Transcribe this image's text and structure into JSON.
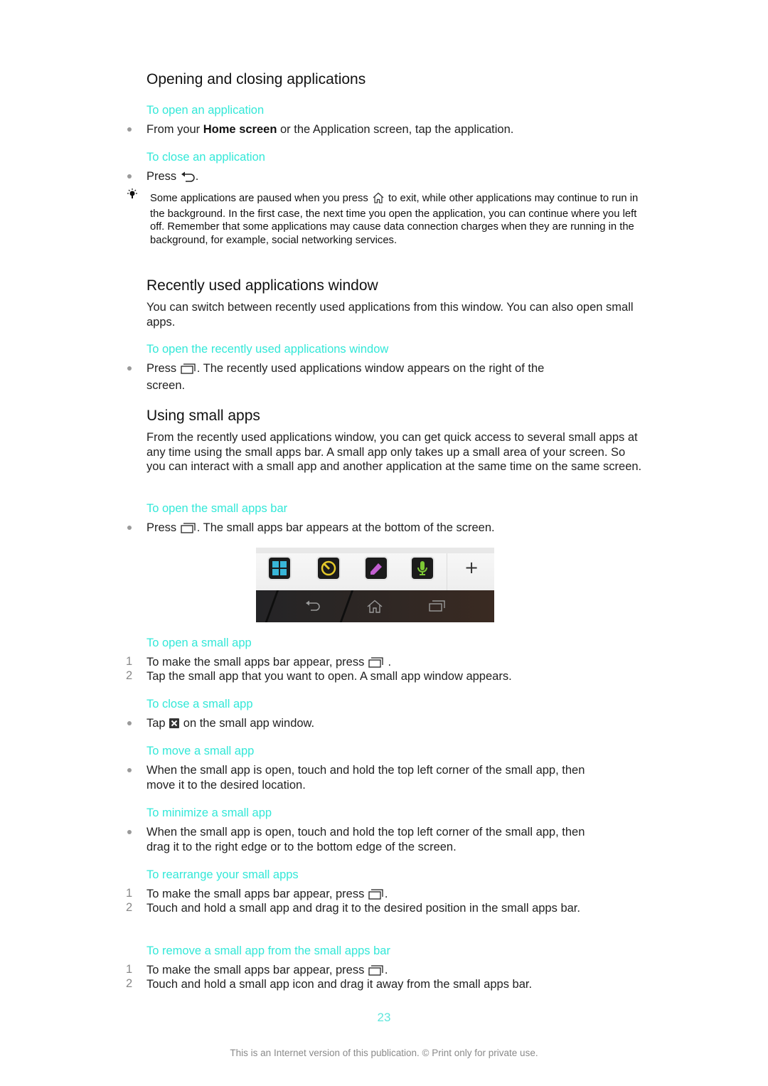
{
  "sections": {
    "opening": {
      "title": "Opening and closing applications",
      "open_heading": "To open an application",
      "open_step_pre": "From your ",
      "open_step_bold": "Home screen",
      "open_step_post": " or the Application screen, tap the application.",
      "close_heading": "To close an application",
      "close_step_pre": "Press ",
      "close_step_post": ".",
      "tip_pre": "Some applications are paused when you press ",
      "tip_post": " to exit, while other applications may continue to run in the background. In the first case, the next time you open the application, you can continue where you left off. Remember that some applications may cause data connection charges when they are running in the background, for example, social networking services."
    },
    "recent": {
      "title": "Recently used applications window",
      "intro": "You can switch between recently used applications from this window. You can also open small apps.",
      "open_heading": "To open the recently used applications window",
      "open_step_pre": "Press ",
      "open_step_post": ". The recently used applications window appears on the right of the screen."
    },
    "small_apps": {
      "title": "Using small apps",
      "intro": "From the recently used applications window, you can get quick access to several small apps at any time using the small apps bar. A small app only takes up a small area of your screen. So you can interact with a small app and another application at the same time on the same screen.",
      "bar_heading": "To open the small apps bar",
      "bar_step_pre": "Press ",
      "bar_step_post": ". The small apps bar appears at the bottom of the screen.",
      "screenshot": {
        "apps": [
          "calculator",
          "timer",
          "notes",
          "voice-recorder"
        ],
        "add_label": "+",
        "nav": [
          "back",
          "home",
          "recent-apps"
        ]
      },
      "open_app": {
        "heading": "To open a small app",
        "steps": [
          {
            "n": "1",
            "pre": "To make the small apps bar appear, press ",
            "post": " ."
          },
          {
            "n": "2",
            "text": "Tap the small app that you want to open. A small app window appears."
          }
        ]
      },
      "close_app": {
        "heading": "To close a small app",
        "pre": "Tap ",
        "post": " on the small app window."
      },
      "move_app": {
        "heading": "To move a small app",
        "text": "When the small app is open, touch and hold the top left corner of the small app, then move it to the desired location."
      },
      "minimize_app": {
        "heading": "To minimize a small app",
        "text": "When the small app is open, touch and hold the top left corner of the small app, then drag it to the right edge or to the bottom edge of the screen."
      },
      "rearrange": {
        "heading": "To rearrange your small apps",
        "steps": [
          {
            "n": "1",
            "pre": "To make the small apps bar appear, press ",
            "post": "."
          },
          {
            "n": "2",
            "text": "Touch and hold a small app and drag it to the desired position in the small apps bar."
          }
        ]
      },
      "remove": {
        "heading": "To remove a small app from the small apps bar",
        "steps": [
          {
            "n": "1",
            "pre": "To make the small apps bar appear, press ",
            "post": "."
          },
          {
            "n": "2",
            "text": "Touch and hold a small app icon and drag it away from the small apps bar."
          }
        ]
      }
    }
  },
  "page_number": "23",
  "footer": "This is an Internet version of this publication. © Print only for private use.",
  "colors": {
    "heading_accent": "#33e8d8",
    "page_number": "#5fe6dc"
  }
}
